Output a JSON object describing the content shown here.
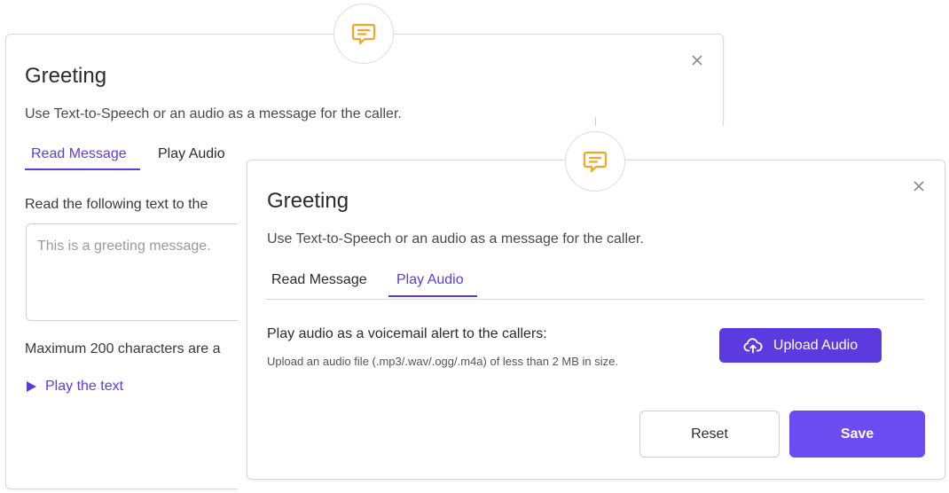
{
  "colors": {
    "accent": "#5b3be0",
    "badge_orange": "#f5a623",
    "border": "#d9d9d9"
  },
  "icons": {
    "badge": "chat-bubble-icon",
    "close": "close-icon",
    "upload": "cloud-upload-icon",
    "play": "play-triangle-icon"
  },
  "back_dialog": {
    "title": "Greeting",
    "subtitle": "Use Text-to-Speech or an audio as a message for the caller.",
    "tabs": [
      {
        "label": "Read Message",
        "active": true
      },
      {
        "label": "Play Audio",
        "active": false
      }
    ],
    "instructions": "Read the following text to the",
    "textarea": {
      "placeholder": "This is a greeting message.",
      "value": ""
    },
    "max_chars_note": "Maximum 200 characters are a",
    "play_text_label": "Play the text"
  },
  "front_dialog": {
    "title": "Greeting",
    "subtitle": "Use Text-to-Speech or an audio as a message for the caller.",
    "tabs": [
      {
        "label": "Read Message",
        "active": false
      },
      {
        "label": "Play Audio",
        "active": true
      }
    ],
    "description": "Play audio as a voicemail alert to the callers:",
    "hint": "Upload an audio file (.mp3/.wav/.ogg/.m4a) of less than 2 MB in size.",
    "upload_label": "Upload Audio",
    "reset_label": "Reset",
    "save_label": "Save"
  }
}
